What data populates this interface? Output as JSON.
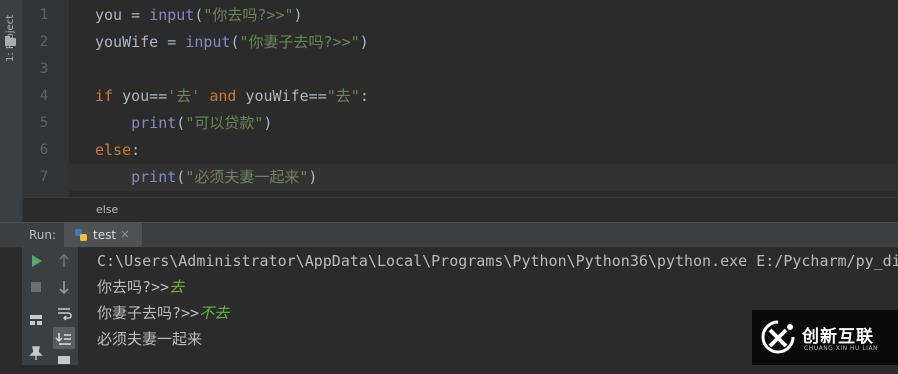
{
  "toolwindow_label": "1: Project",
  "editor": {
    "lines": [
      {
        "n": "1"
      },
      {
        "n": "2"
      },
      {
        "n": "3"
      },
      {
        "n": "4"
      },
      {
        "n": "5"
      },
      {
        "n": "6"
      },
      {
        "n": "7"
      }
    ],
    "tokens": {
      "l1_a": "you = ",
      "l1_b": "input",
      "l1_c": "(",
      "l1_d": "\"你去吗?>>\"",
      "l1_e": ")",
      "l2_a": "youWife = ",
      "l2_b": "input",
      "l2_c": "(",
      "l2_d": "\"你妻子去吗?>>\"",
      "l2_e": ")",
      "l4_a": "if",
      "l4_b": " you==",
      "l4_c": "'去'",
      "l4_d": " and",
      "l4_e": " youWife==",
      "l4_f": "\"去\"",
      "l4_g": ":",
      "l5_a": "    print",
      "l5_b": "(",
      "l5_c": "\"可以贷款\"",
      "l5_d": ")",
      "l6_a": "else",
      "l6_b": ":",
      "l7_a": "    print",
      "l7_b": "(",
      "l7_c": "\"必须夫妻一起来\"",
      "l7_d": ")"
    },
    "breadcrumb": "else"
  },
  "run": {
    "label": "Run:",
    "tab_label": "test",
    "close_glyph": "×"
  },
  "console": {
    "cmd": "C:\\Users\\Administrator\\AppData\\Local\\Programs\\Python\\Python36\\python.exe E:/Pycharm/py_di",
    "prompt1": "你去吗?>>",
    "input1": "去",
    "prompt2": "你妻子去吗?>>",
    "input2": "不去",
    "output": "必须夫妻一起来"
  },
  "watermark": {
    "brand": "创新互联",
    "sub": "CHUANG XIN HU LIAN"
  },
  "colors": {
    "keyword": "#cc7832",
    "builtin": "#8888c6",
    "string": "#6a8759",
    "user_input": "#62b543",
    "run_green": "#59a869"
  },
  "icons": [
    "folder-icon",
    "python-file-icon",
    "run-icon",
    "stop-icon",
    "rerun-up-icon",
    "scroll-down-icon",
    "soft-wrap-icon",
    "scroll-to-end-icon",
    "layout-icon",
    "pin-icon",
    "print-icon"
  ]
}
